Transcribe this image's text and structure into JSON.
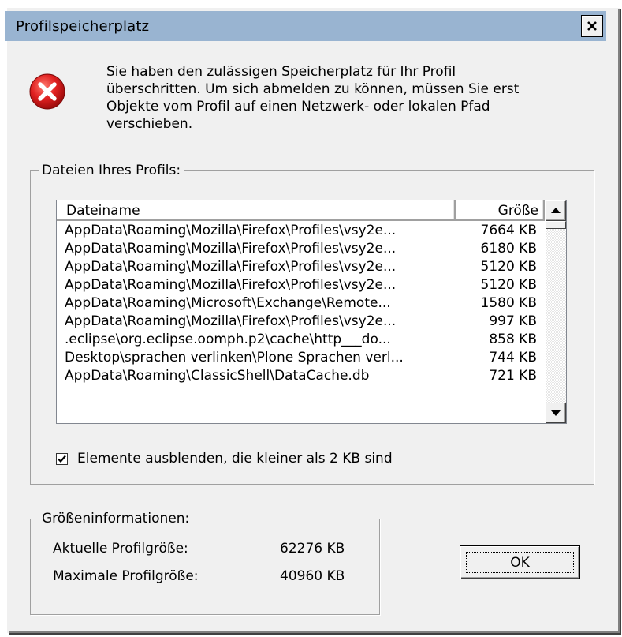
{
  "dialog": {
    "title": "Profilspeicherplatz",
    "close_label": "✕",
    "icon": "error-icon",
    "message_lines": [
      "Sie haben den zulässigen Speicherplatz für Ihr Profil",
      "überschritten. Um sich abmelden zu können, müssen Sie erst",
      "Objekte vom Profil auf einen Netzwerk- oder lokalen Pfad",
      "verschieben."
    ]
  },
  "files_group": {
    "label": "Dateien Ihres Profils:",
    "columns": {
      "name": "Dateiname",
      "size": "Größe"
    },
    "rows": [
      {
        "name": "AppData\\Roaming\\Mozilla\\Firefox\\Profiles\\vsy2e...",
        "size": "7664 KB"
      },
      {
        "name": "AppData\\Roaming\\Mozilla\\Firefox\\Profiles\\vsy2e...",
        "size": "6180 KB"
      },
      {
        "name": "AppData\\Roaming\\Mozilla\\Firefox\\Profiles\\vsy2e...",
        "size": "5120 KB"
      },
      {
        "name": "AppData\\Roaming\\Mozilla\\Firefox\\Profiles\\vsy2e...",
        "size": "5120 KB"
      },
      {
        "name": "AppData\\Roaming\\Microsoft\\Exchange\\Remote...",
        "size": "1580 KB"
      },
      {
        "name": "AppData\\Roaming\\Mozilla\\Firefox\\Profiles\\vsy2e...",
        "size": "997 KB"
      },
      {
        "name": ".eclipse\\org.eclipse.oomph.p2\\cache\\http___do...",
        "size": "858 KB"
      },
      {
        "name": "Desktop\\sprachen verlinken\\Plone Sprachen verl...",
        "size": "744 KB"
      },
      {
        "name": "AppData\\Roaming\\ClassicShell\\DataCache.db",
        "size": "721 KB"
      }
    ],
    "hide_small_checked": true,
    "hide_small_label": "Elemente ausblenden, die kleiner als 2 KB sind"
  },
  "size_info": {
    "label": "Größeninformationen:",
    "current_label": "Aktuelle Profilgröße:",
    "current_value": "62276 KB",
    "max_label": "Maximale Profilgröße:",
    "max_value": "40960 KB"
  },
  "buttons": {
    "ok_label": "OK"
  },
  "colors": {
    "titlebar": "#99b4d1",
    "dialog_bg": "#f0f0f0",
    "error_red": "#e02020"
  }
}
